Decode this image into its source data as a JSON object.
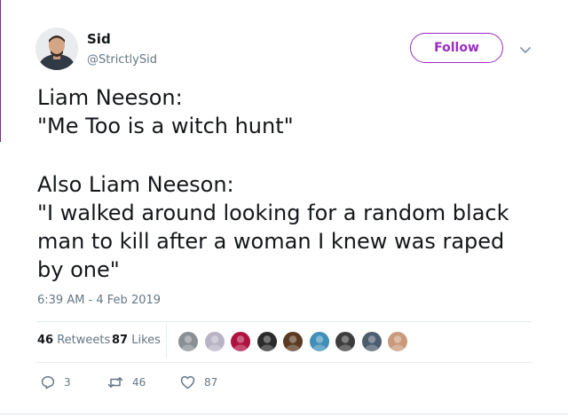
{
  "user": {
    "name": "Sid",
    "handle": "@StrictlySid",
    "follow_label": "Follow"
  },
  "tweet": {
    "lines": [
      "Liam Neeson:",
      "\"Me Too is a witch hunt\"",
      "Also Liam Neeson:",
      "\"I walked around looking for a random black",
      "man to kill after a woman I knew was raped",
      "by one\""
    ],
    "timestamp": "6:39 AM - 4 Feb 2019"
  },
  "stats": {
    "retweets_count": "46",
    "retweets_label": "Retweets",
    "likes_count": "87",
    "likes_label": "Likes"
  },
  "likers": [
    {
      "icon": "user-avatar-1",
      "color": "#8a8f94"
    },
    {
      "icon": "user-avatar-2",
      "color": "#b9b3c6"
    },
    {
      "icon": "user-avatar-3",
      "color": "#b0123f"
    },
    {
      "icon": "user-avatar-4",
      "color": "#2b2b2b"
    },
    {
      "icon": "user-avatar-5",
      "color": "#5a3a22"
    },
    {
      "icon": "user-avatar-6",
      "color": "#3f8fb8"
    },
    {
      "icon": "user-avatar-7",
      "color": "#3c3c3c"
    },
    {
      "icon": "user-avatar-8",
      "color": "#4c5d6e"
    },
    {
      "icon": "user-avatar-9",
      "color": "#c99a7a"
    }
  ],
  "actions": {
    "replies": "3",
    "retweets": "46",
    "likes": "87"
  },
  "colors": {
    "accent": "#9b2bc4",
    "text": "#14171a",
    "muted": "#657786"
  }
}
